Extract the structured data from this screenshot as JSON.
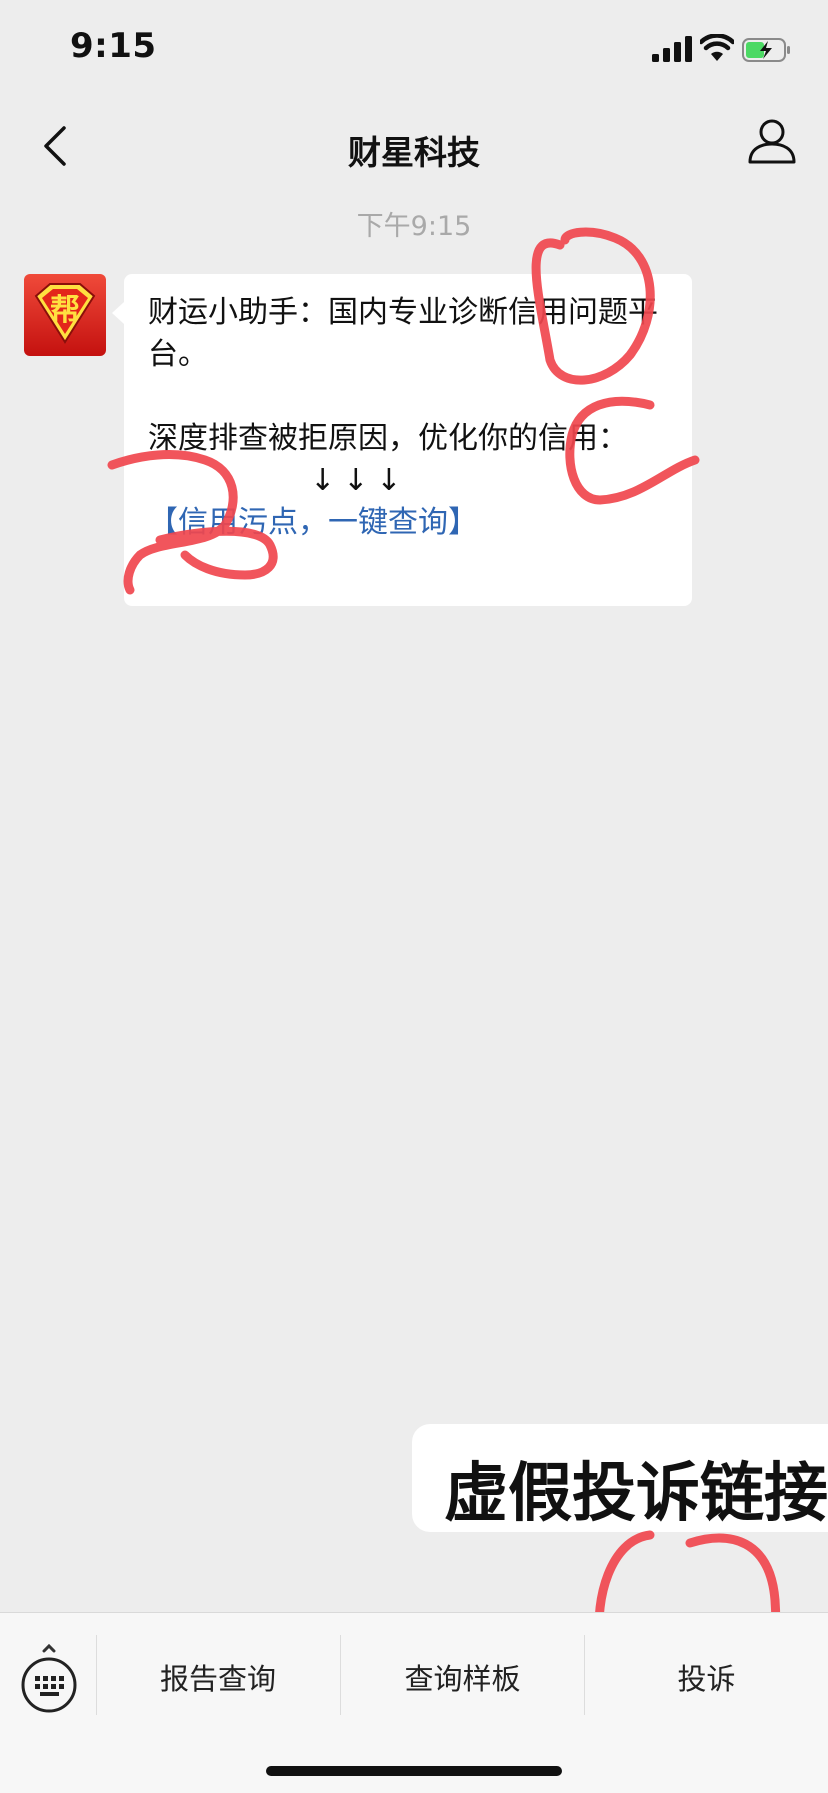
{
  "status_bar": {
    "time": "9:15",
    "icons": [
      "cellular-signal-icon",
      "wifi-icon",
      "battery-charging-icon"
    ]
  },
  "nav": {
    "title": "财星科技",
    "back_icon": "chevron-left-icon",
    "profile_icon": "person-icon"
  },
  "chat": {
    "timestamp": "下午9:15",
    "message": {
      "avatar_glyph": "帮",
      "line1": "财运小助手：国内专业诊断信用问题平台。",
      "line2": "深度排查被拒原因，优化你的信用：",
      "arrows": "↓↓↓",
      "link": "【信用污点，一键查询】"
    }
  },
  "callout": {
    "text": "虚假投诉链接"
  },
  "menu": {
    "keyboard_icon": "keyboard-icon",
    "items": [
      "报告查询",
      "查询样板",
      "投诉"
    ]
  },
  "colors": {
    "background": "#ededed",
    "link": "#2f66b3",
    "annotation": "#f0474e"
  }
}
